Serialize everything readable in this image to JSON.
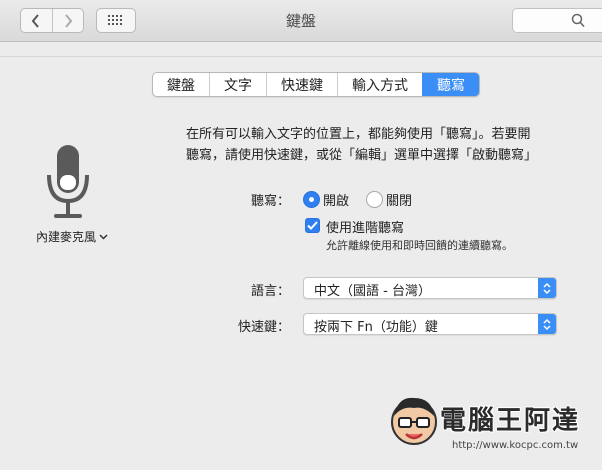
{
  "window": {
    "title": "鍵盤"
  },
  "tabs": [
    {
      "label": "鍵盤",
      "active": false
    },
    {
      "label": "文字",
      "active": false
    },
    {
      "label": "快速鍵",
      "active": false
    },
    {
      "label": "輸入方式",
      "active": false
    },
    {
      "label": "聽寫",
      "active": true
    }
  ],
  "mic": {
    "source_label": "內建麥克風"
  },
  "description": {
    "line1": "在所有可以輸入文字的位置上，都能夠使用「聽寫」。若要開",
    "line2": "聽寫，請使用快速鍵，或從「編輯」選單中選擇「啟動聽寫」"
  },
  "dictation": {
    "label": "聽寫：",
    "option_on": "開啟",
    "option_off": "關閉",
    "selected": "開啟"
  },
  "enhanced": {
    "label": "使用進階聽寫",
    "checked": true,
    "hint": "允許離線使用和即時回饋的連續聽寫。"
  },
  "language": {
    "label": "語言：",
    "value": "中文（國語 - 台灣）"
  },
  "shortcut": {
    "label": "快速鍵：",
    "value": "按兩下 Fn（功能）鍵"
  },
  "watermark": {
    "title": "電腦王阿達",
    "url": "http://www.kocpc.com.tw"
  },
  "colors": {
    "accent": "#3b8ef5",
    "background": "#ececec"
  },
  "icons": [
    "chevron-left-icon",
    "chevron-right-icon",
    "grid-icon",
    "search-icon",
    "microphone-icon",
    "chevron-down-icon",
    "checkmark-icon",
    "updown-arrows-icon"
  ]
}
